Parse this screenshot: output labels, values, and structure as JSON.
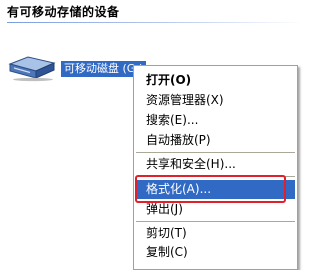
{
  "section": {
    "title": "有可移动存储的设备"
  },
  "drive": {
    "label": "可移动磁盘 (G:)",
    "icon": "removable-disk-icon"
  },
  "context_menu": {
    "items": [
      {
        "label": "打开(O)",
        "bold": true
      },
      {
        "label": "资源管理器(X)"
      },
      {
        "label": "搜索(E)..."
      },
      {
        "label": "自动播放(P)"
      },
      {
        "label": "共享和安全(H)..."
      },
      {
        "label": "格式化(A)...",
        "selected": true,
        "highlighted": true
      },
      {
        "label": "弹出(J)"
      },
      {
        "label": "剪切(T)"
      },
      {
        "label": "复制(C)"
      }
    ]
  },
  "colors": {
    "selection": "#316ac5",
    "highlight_border": "#e0202a",
    "divider": "#7a9de0"
  }
}
